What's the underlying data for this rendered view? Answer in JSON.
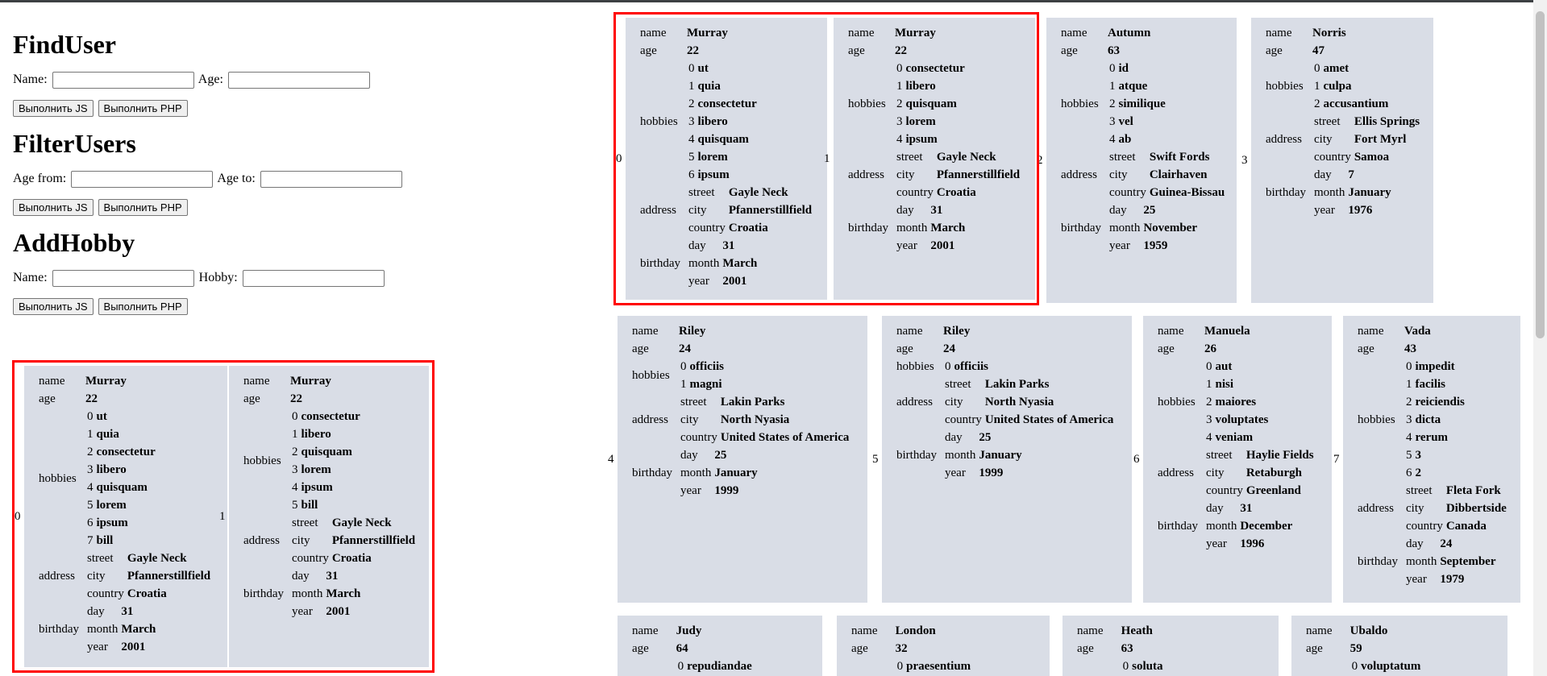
{
  "sections": {
    "find": {
      "title": "FindUser",
      "name_label": "Name:",
      "age_label": "Age:",
      "btn_js": "Выполнить JS",
      "btn_php": "Выполнить PHP"
    },
    "filter": {
      "title": "FilterUsers",
      "from_label": "Age from:",
      "to_label": "Age to:",
      "btn_js": "Выполнить JS",
      "btn_php": "Выполнить PHP"
    },
    "addhobby": {
      "title": "AddHobby",
      "name_label": "Name:",
      "hobby_label": "Hobby:",
      "btn_js": "Выполнить JS",
      "btn_php": "Выполнить PHP"
    }
  },
  "labels": {
    "name": "name",
    "age": "age",
    "hobbies": "hobbies",
    "address": "address",
    "street": "street",
    "city": "city",
    "country": "country",
    "birthday": "birthday",
    "day": "day",
    "month": "month",
    "year": "year"
  },
  "left_cards": [
    {
      "idx": "0",
      "name": "Murray",
      "age": "22",
      "hobbies": [
        "ut",
        "quia",
        "consectetur",
        "libero",
        "quisquam",
        "lorem",
        "ipsum",
        "bill"
      ],
      "street": "Gayle Neck",
      "city": "Pfannerstillfield",
      "country": "Croatia",
      "day": "31",
      "month": "March",
      "year": "2001"
    },
    {
      "idx": "1",
      "name": "Murray",
      "age": "22",
      "hobbies": [
        "consectetur",
        "libero",
        "quisquam",
        "lorem",
        "ipsum",
        "bill"
      ],
      "street": "Gayle Neck",
      "city": "Pfannerstillfield",
      "country": "Croatia",
      "day": "31",
      "month": "March",
      "year": "2001"
    }
  ],
  "top_cards": [
    {
      "idx": "0",
      "name": "Murray",
      "age": "22",
      "hobbies": [
        "ut",
        "quia",
        "consectetur",
        "libero",
        "quisquam",
        "lorem",
        "ipsum"
      ],
      "street": "Gayle Neck",
      "city": "Pfannerstillfield",
      "country": "Croatia",
      "day": "31",
      "month": "March",
      "year": "2001"
    },
    {
      "idx": "1",
      "name": "Murray",
      "age": "22",
      "hobbies": [
        "consectetur",
        "libero",
        "quisquam",
        "lorem",
        "ipsum"
      ],
      "street": "Gayle Neck",
      "city": "Pfannerstillfield",
      "country": "Croatia",
      "day": "31",
      "month": "March",
      "year": "2001"
    },
    {
      "idx": "2",
      "name": "Autumn",
      "age": "63",
      "hobbies": [
        "id",
        "atque",
        "similique",
        "vel",
        "ab"
      ],
      "street": "Swift Fords",
      "city": "Clairhaven",
      "country": "Guinea-Bissau",
      "day": "25",
      "month": "November",
      "year": "1959"
    },
    {
      "idx": "3",
      "name": "Norris",
      "age": "47",
      "hobbies": [
        "amet",
        "culpa",
        "accusantium"
      ],
      "street": "Ellis Springs",
      "city": "Fort Myrl",
      "country": "Samoa",
      "day": "7",
      "month": "January",
      "year": "1976"
    }
  ],
  "mid_cards": [
    {
      "idx": "4",
      "name": "Riley",
      "age": "24",
      "hobbies": [
        "officiis",
        "magni"
      ],
      "street": "Lakin Parks",
      "city": "North Nyasia",
      "country": "United States of America",
      "day": "25",
      "month": "January",
      "year": "1999"
    },
    {
      "idx": "5",
      "name": "Riley",
      "age": "24",
      "hobbies": [
        "officiis"
      ],
      "street": "Lakin Parks",
      "city": "North Nyasia",
      "country": "United States of America",
      "day": "25",
      "month": "January",
      "year": "1999"
    },
    {
      "idx": "6",
      "name": "Manuela",
      "age": "26",
      "hobbies": [
        "aut",
        "nisi",
        "maiores",
        "voluptates",
        "veniam"
      ],
      "street": "Haylie Fields",
      "city": "Retaburgh",
      "country": "Greenland",
      "day": "31",
      "month": "December",
      "year": "1996"
    },
    {
      "idx": "7",
      "name": "Vada",
      "age": "43",
      "hobbies": [
        "impedit",
        "facilis",
        "reiciendis",
        "dicta",
        "rerum",
        "3",
        "2"
      ],
      "street": "Fleta Fork",
      "city": "Dibbertside",
      "country": "Canada",
      "day": "24",
      "month": "September",
      "year": "1979"
    }
  ],
  "bottom_cards": [
    {
      "name": "Judy",
      "age": "64",
      "first_hobby": "repudiandae"
    },
    {
      "name": "London",
      "age": "32",
      "first_hobby": "praesentium"
    },
    {
      "name": "Heath",
      "age": "63",
      "first_hobby": "soluta"
    },
    {
      "name": "Ubaldo",
      "age": "59",
      "first_hobby": "voluptatum"
    }
  ]
}
